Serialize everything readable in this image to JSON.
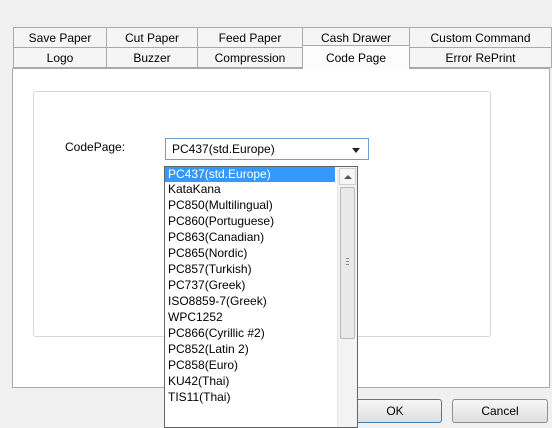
{
  "tabs_row1": [
    {
      "label": "Save Paper"
    },
    {
      "label": "Cut Paper"
    },
    {
      "label": "Feed Paper"
    },
    {
      "label": "Cash Drawer"
    },
    {
      "label": "Custom Command"
    }
  ],
  "tabs_row2": [
    {
      "label": "Logo"
    },
    {
      "label": "Buzzer"
    },
    {
      "label": "Compression"
    },
    {
      "label": "Code Page",
      "active": true
    },
    {
      "label": "Error RePrint"
    }
  ],
  "codepage": {
    "label": "CodePage:",
    "selected_value": "PC437(std.Europe)"
  },
  "dropdown": {
    "items": [
      "PC437(std.Europe)",
      "KataKana",
      "PC850(Multilingual)",
      "PC860(Portuguese)",
      "PC863(Canadian)",
      "PC865(Nordic)",
      "PC857(Turkish)",
      "PC737(Greek)",
      "ISO8859-7(Greek)",
      "WPC1252",
      "PC866(Cyrillic #2)",
      "PC852(Latin 2)",
      "PC858(Euro)",
      "KU42(Thai)",
      "TIS11(Thai)"
    ],
    "highlighted_index": 0
  },
  "buttons": {
    "ok": "OK",
    "cancel": "Cancel"
  }
}
